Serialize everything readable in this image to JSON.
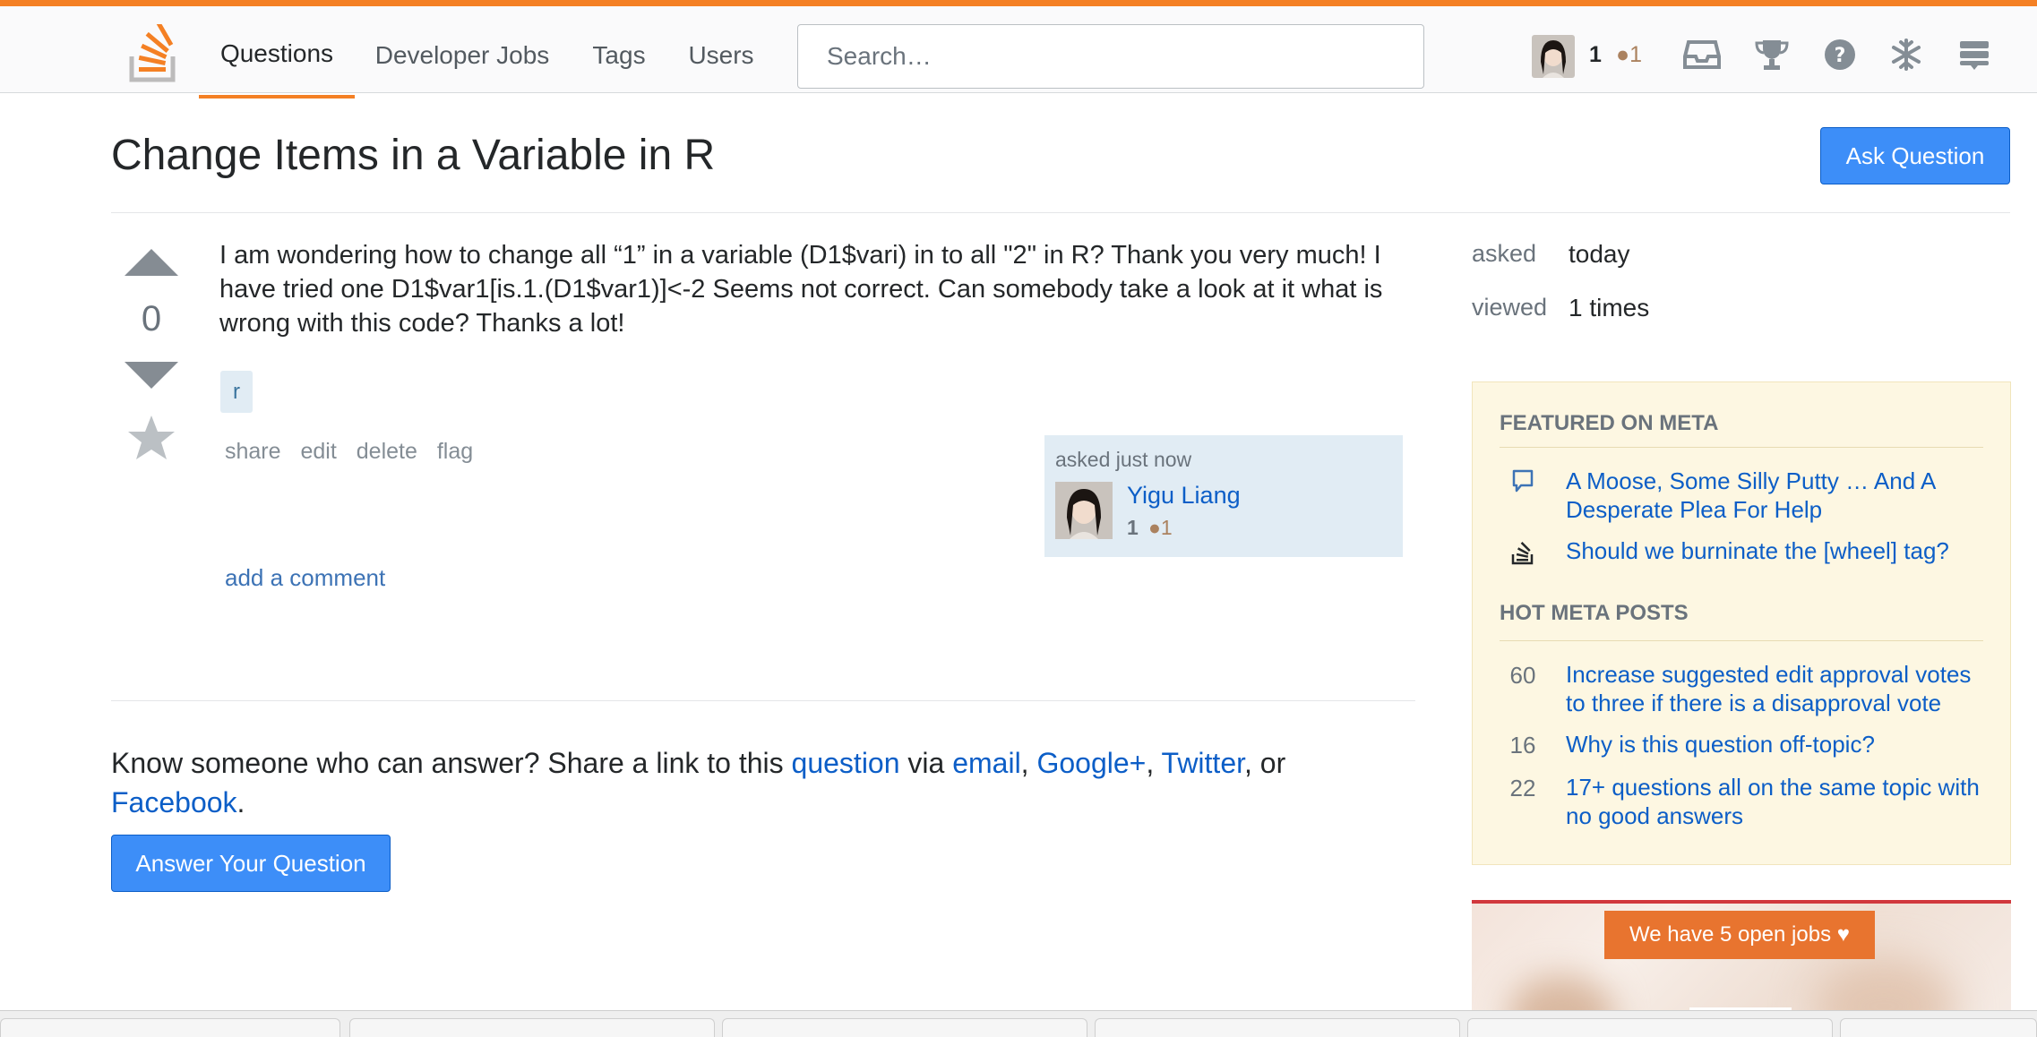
{
  "topbar": {
    "nav": [
      "Questions",
      "Developer Jobs",
      "Tags",
      "Users"
    ],
    "active_nav": "Questions",
    "search_placeholder": "Search…",
    "user": {
      "reputation": "1",
      "bronze_badges": "●1"
    },
    "accent_color": "#f48024"
  },
  "question": {
    "title": "Change Items in a Variable in R",
    "ask_button": "Ask Question",
    "vote_count": "0",
    "body": "I am wondering how to change all “1” in a variable (D1$vari) in to all \"2\" in R? Thank you very much! I have tried one D1$var1[is.1.(D1$var1)]<-2 Seems not correct. Can somebody take a look at it what is wrong with this code? Thanks a lot!",
    "tags": [
      "r"
    ],
    "menu": [
      "share",
      "edit",
      "delete",
      "flag"
    ],
    "owner": {
      "asked": "asked just now",
      "name": "Yigu Liang",
      "reputation": "1",
      "bronze_badges": "●1"
    },
    "add_comment": "add a comment"
  },
  "share": {
    "prefix": "Know someone who can answer? Share a link to this ",
    "question_link": "question",
    "via": " via ",
    "email": "email",
    "sep1": ", ",
    "google": "Google+",
    "sep2": ", ",
    "twitter": "Twitter",
    "or": ", or",
    "facebook": "Facebook",
    "period": ".",
    "answer_button": "Answer Your Question"
  },
  "sidebar": {
    "asked_label": "asked",
    "asked_value": "today",
    "viewed_label": "viewed",
    "viewed_value": "1 times",
    "featured_heading": "FEATURED ON META",
    "featured": [
      {
        "icon": "speech-bubble-icon",
        "text": "A Moose, Some Silly Putty … And A Desperate Plea For Help"
      },
      {
        "icon": "stack-overflow-icon",
        "text": "Should we burninate the [wheel] tag?"
      }
    ],
    "hot_heading": "HOT META POSTS",
    "hot": [
      {
        "count": "60",
        "text": "Increase suggested edit approval votes to three if there is a disapproval vote"
      },
      {
        "count": "16",
        "text": "Why is this question off-topic?"
      },
      {
        "count": "22",
        "text": "17+ questions all on the same topic with no good answers"
      }
    ],
    "jobs_button": "We have 5 open jobs ♥"
  }
}
